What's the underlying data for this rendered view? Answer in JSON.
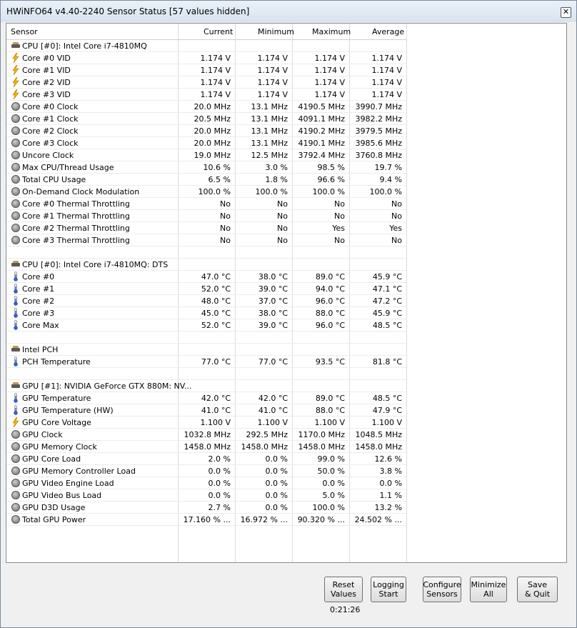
{
  "window": {
    "title": "HWiNFO64 v4.40-2240 Sensor Status [57 values hidden]",
    "close_glyph": "✕"
  },
  "columns": [
    "Sensor",
    "Current",
    "Minimum",
    "Maximum",
    "Average"
  ],
  "rows": [
    {
      "type": "group",
      "icon": "chip",
      "label": "CPU [#0]: Intel Core i7-4810MQ"
    },
    {
      "icon": "bolt",
      "label": "Core #0 VID",
      "cur": "1.174 V",
      "min": "1.174 V",
      "max": "1.174 V",
      "avg": "1.174 V"
    },
    {
      "icon": "bolt",
      "label": "Core #1 VID",
      "cur": "1.174 V",
      "min": "1.174 V",
      "max": "1.174 V",
      "avg": "1.174 V"
    },
    {
      "icon": "bolt",
      "label": "Core #2 VID",
      "cur": "1.174 V",
      "min": "1.174 V",
      "max": "1.174 V",
      "avg": "1.174 V"
    },
    {
      "icon": "bolt",
      "label": "Core #3 VID",
      "cur": "1.174 V",
      "min": "1.174 V",
      "max": "1.174 V",
      "avg": "1.174 V"
    },
    {
      "icon": "dial",
      "label": "Core #0 Clock",
      "cur": "20.0 MHz",
      "min": "13.1 MHz",
      "max": "4190.5 MHz",
      "avg": "3990.7 MHz"
    },
    {
      "icon": "dial",
      "label": "Core #1 Clock",
      "cur": "20.5 MHz",
      "min": "13.1 MHz",
      "max": "4091.1 MHz",
      "avg": "3982.2 MHz"
    },
    {
      "icon": "dial",
      "label": "Core #2 Clock",
      "cur": "20.0 MHz",
      "min": "13.1 MHz",
      "max": "4190.2 MHz",
      "avg": "3979.5 MHz"
    },
    {
      "icon": "dial",
      "label": "Core #3 Clock",
      "cur": "20.0 MHz",
      "min": "13.1 MHz",
      "max": "4190.1 MHz",
      "avg": "3985.6 MHz"
    },
    {
      "icon": "dial",
      "label": "Uncore Clock",
      "cur": "19.0 MHz",
      "min": "12.5 MHz",
      "max": "3792.4 MHz",
      "avg": "3760.8 MHz"
    },
    {
      "icon": "dial",
      "label": "Max CPU/Thread Usage",
      "cur": "10.6 %",
      "min": "3.0 %",
      "max": "98.5 %",
      "avg": "19.7 %"
    },
    {
      "icon": "dial",
      "label": "Total CPU Usage",
      "cur": "6.5 %",
      "min": "1.8 %",
      "max": "96.6 %",
      "avg": "9.4 %"
    },
    {
      "icon": "dial",
      "label": "On-Demand Clock Modulation",
      "cur": "100.0 %",
      "min": "100.0 %",
      "max": "100.0 %",
      "avg": "100.0 %"
    },
    {
      "icon": "dial",
      "label": "Core #0 Thermal Throttling",
      "cur": "No",
      "min": "No",
      "max": "No",
      "avg": "No"
    },
    {
      "icon": "dial",
      "label": "Core #1 Thermal Throttling",
      "cur": "No",
      "min": "No",
      "max": "No",
      "avg": "No"
    },
    {
      "icon": "dial",
      "label": "Core #2 Thermal Throttling",
      "cur": "No",
      "min": "No",
      "max": "Yes",
      "avg": "Yes"
    },
    {
      "icon": "dial",
      "label": "Core #3 Thermal Throttling",
      "cur": "No",
      "min": "No",
      "max": "No",
      "avg": "No"
    },
    {
      "type": "blank"
    },
    {
      "type": "group",
      "icon": "chip",
      "label": "CPU [#0]: Intel Core i7-4810MQ: DTS"
    },
    {
      "icon": "thermo",
      "label": "Core #0",
      "cur": "47.0 °C",
      "min": "38.0 °C",
      "max": "89.0 °C",
      "avg": "45.9 °C"
    },
    {
      "icon": "thermo",
      "label": "Core #1",
      "cur": "52.0 °C",
      "min": "39.0 °C",
      "max": "94.0 °C",
      "avg": "47.1 °C"
    },
    {
      "icon": "thermo",
      "label": "Core #2",
      "cur": "48.0 °C",
      "min": "37.0 °C",
      "max": "96.0 °C",
      "avg": "47.2 °C"
    },
    {
      "icon": "thermo",
      "label": "Core #3",
      "cur": "45.0 °C",
      "min": "38.0 °C",
      "max": "88.0 °C",
      "avg": "45.9 °C"
    },
    {
      "icon": "thermo",
      "label": "Core Max",
      "cur": "52.0 °C",
      "min": "39.0 °C",
      "max": "96.0 °C",
      "avg": "48.5 °C"
    },
    {
      "type": "blank"
    },
    {
      "type": "group",
      "icon": "chip",
      "label": "Intel PCH"
    },
    {
      "icon": "thermo",
      "label": "PCH Temperature",
      "cur": "77.0 °C",
      "min": "77.0 °C",
      "max": "93.5 °C",
      "avg": "81.8 °C"
    },
    {
      "type": "blank"
    },
    {
      "type": "group",
      "icon": "chip",
      "label": "GPU [#1]: NVIDIA GeForce GTX 880M: NV..."
    },
    {
      "icon": "thermo",
      "label": "GPU Temperature",
      "cur": "42.0 °C",
      "min": "42.0 °C",
      "max": "89.0 °C",
      "avg": "48.5 °C"
    },
    {
      "icon": "thermo",
      "label": "GPU Temperature (HW)",
      "cur": "41.0 °C",
      "min": "41.0 °C",
      "max": "88.0 °C",
      "avg": "47.9 °C"
    },
    {
      "icon": "bolt",
      "label": "GPU Core Voltage",
      "cur": "1.100 V",
      "min": "1.100 V",
      "max": "1.100 V",
      "avg": "1.100 V"
    },
    {
      "icon": "dial",
      "label": "GPU Clock",
      "cur": "1032.8 MHz",
      "min": "292.5 MHz",
      "max": "1170.0 MHz",
      "avg": "1048.5 MHz"
    },
    {
      "icon": "dial",
      "label": "GPU Memory Clock",
      "cur": "1458.0 MHz",
      "min": "1458.0 MHz",
      "max": "1458.0 MHz",
      "avg": "1458.0 MHz"
    },
    {
      "icon": "dial",
      "label": "GPU Core Load",
      "cur": "2.0 %",
      "min": "0.0 %",
      "max": "99.0 %",
      "avg": "12.6 %"
    },
    {
      "icon": "dial",
      "label": "GPU Memory Controller Load",
      "cur": "0.0 %",
      "min": "0.0 %",
      "max": "50.0 %",
      "avg": "3.8 %"
    },
    {
      "icon": "dial",
      "label": "GPU Video Engine Load",
      "cur": "0.0 %",
      "min": "0.0 %",
      "max": "0.0 %",
      "avg": "0.0 %"
    },
    {
      "icon": "dial",
      "label": "GPU Video Bus Load",
      "cur": "0.0 %",
      "min": "0.0 %",
      "max": "5.0 %",
      "avg": "1.1 %"
    },
    {
      "icon": "dial",
      "label": "GPU D3D Usage",
      "cur": "2.7 %",
      "min": "0.0 %",
      "max": "100.0 %",
      "avg": "13.2 %"
    },
    {
      "icon": "dial",
      "label": "Total GPU Power",
      "cur": "17.160 % ...",
      "min": "16.972 % ...",
      "max": "90.320 % ...",
      "avg": "24.502 % ..."
    }
  ],
  "buttons": [
    {
      "name": "reset-values-button",
      "label": "Reset\nValues"
    },
    {
      "name": "logging-start-button",
      "label": "Logging\nStart"
    },
    {
      "name": "configure-sensors-button",
      "label": "Configure\nSensors"
    },
    {
      "name": "minimize-all-button",
      "label": "Minimize\nAll"
    },
    {
      "name": "save-quit-button",
      "label": "Save\n& Quit"
    }
  ],
  "timer": "0:21:26"
}
